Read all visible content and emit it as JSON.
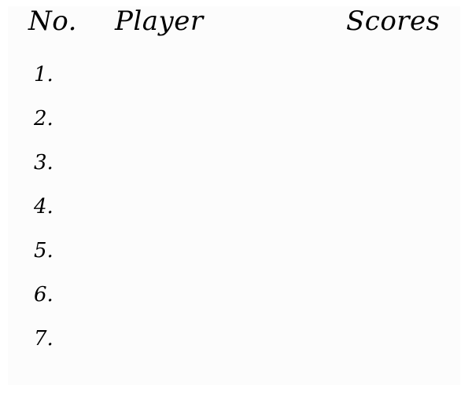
{
  "leaderboard": {
    "headers": {
      "number": "No.",
      "player": "Player",
      "scores": "Scores"
    },
    "rows": [
      {
        "rank": "1.",
        "player": "",
        "score": ""
      },
      {
        "rank": "2.",
        "player": "",
        "score": ""
      },
      {
        "rank": "3.",
        "player": "",
        "score": ""
      },
      {
        "rank": "4.",
        "player": "",
        "score": ""
      },
      {
        "rank": "5.",
        "player": "",
        "score": ""
      },
      {
        "rank": "6.",
        "player": "",
        "score": ""
      },
      {
        "rank": "7.",
        "player": "",
        "score": ""
      }
    ]
  }
}
